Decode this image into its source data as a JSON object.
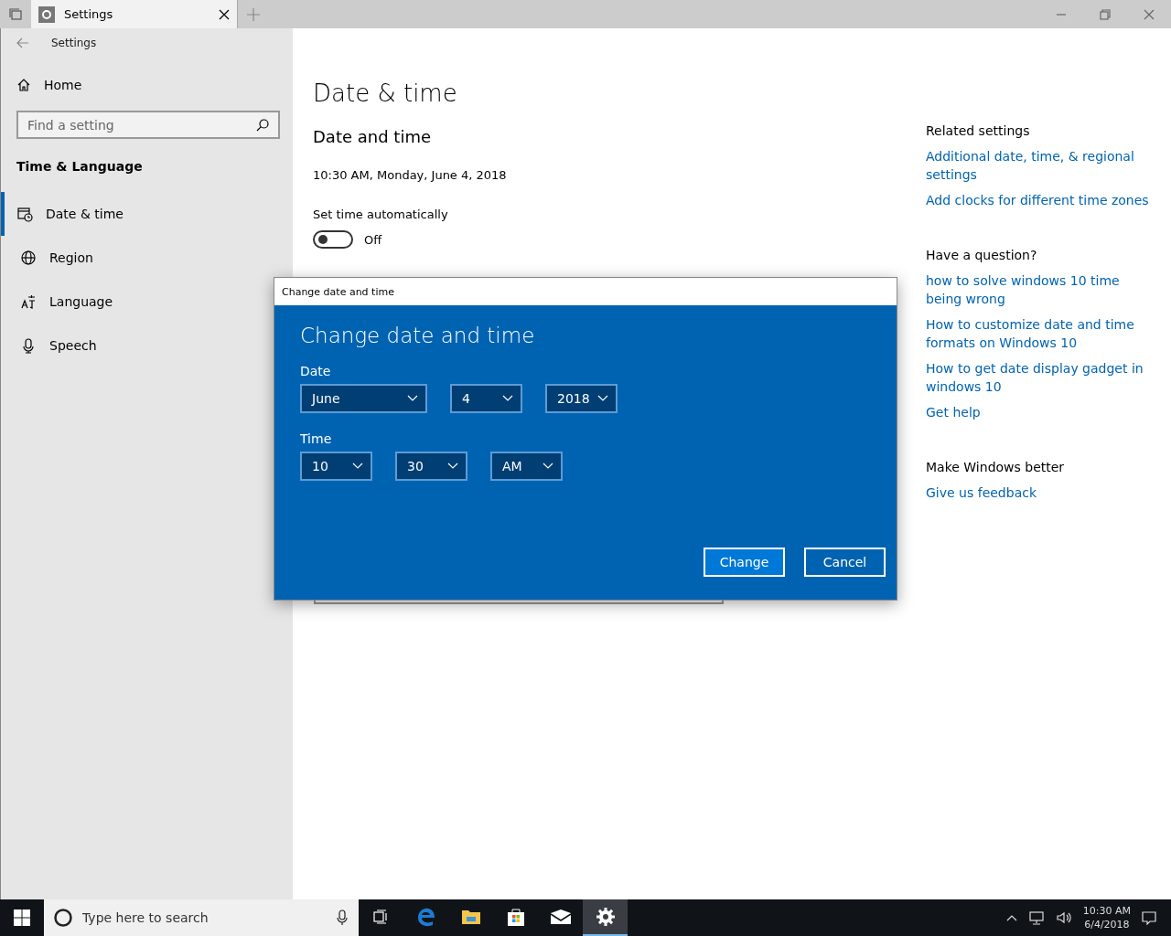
{
  "window": {
    "tab_title": "Settings"
  },
  "sidebar": {
    "back_title": "Settings",
    "home": "Home",
    "search": {
      "placeholder": "Find a setting"
    },
    "section": "Time & Language",
    "items": [
      {
        "label": "Date & time",
        "selected": true
      },
      {
        "label": "Region",
        "selected": false
      },
      {
        "label": "Language",
        "selected": false
      },
      {
        "label": "Speech",
        "selected": false
      }
    ]
  },
  "content": {
    "title": "Date & time",
    "subtitle": "Date and time",
    "current": "10:30 AM, Monday, June 4, 2018",
    "auto_time": {
      "label": "Set time automatically",
      "on": false,
      "state_text": "Off"
    }
  },
  "side_groups": [
    {
      "heading": "Related settings",
      "links": [
        "Additional date, time, & regional settings",
        "Add clocks for different time zones"
      ]
    },
    {
      "heading": "Have a question?",
      "links": [
        "how to solve windows 10 time being wrong",
        "How to customize date and time formats on Windows 10",
        "How to get date display gadget in windows 10",
        "Get help"
      ]
    },
    {
      "heading": "Make Windows better",
      "links": [
        "Give us feedback"
      ]
    }
  ],
  "dialog": {
    "window_title": "Change date and time",
    "heading": "Change date and time",
    "date_label": "Date",
    "date_fields": [
      {
        "value": "June"
      },
      {
        "value": "4"
      },
      {
        "value": "2018"
      }
    ],
    "time_label": "Time",
    "time_fields": [
      {
        "value": "10"
      },
      {
        "value": "30"
      },
      {
        "value": "AM"
      }
    ],
    "buttons": [
      "Change",
      "Cancel"
    ]
  },
  "taskbar": {
    "search_placeholder": "Type here to search",
    "apps": [
      {
        "selected": false
      },
      {
        "selected": false
      },
      {
        "selected": false
      },
      {
        "selected": false
      },
      {
        "selected": false
      },
      {
        "selected": true
      }
    ],
    "clock_time": "10:30 AM",
    "clock_date": "6/4/2018"
  }
}
